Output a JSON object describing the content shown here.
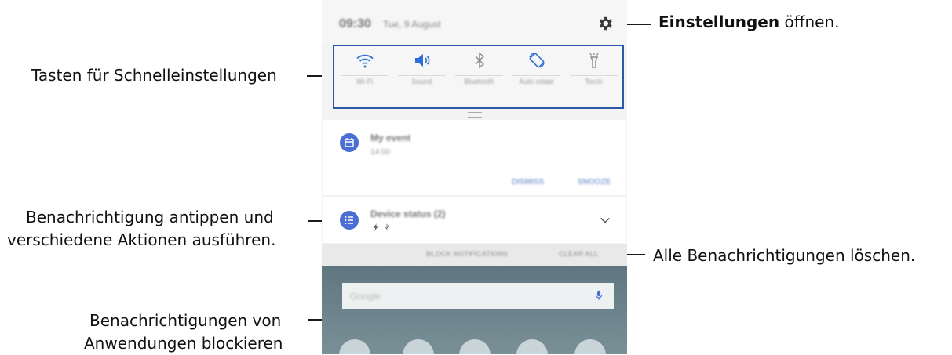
{
  "status_bar": {
    "time": "09:30",
    "date": "Tue, 9 August"
  },
  "quick_settings": [
    {
      "label": "Wi-Fi",
      "icon": "wifi-icon"
    },
    {
      "label": "Sound",
      "icon": "volume-icon"
    },
    {
      "label": "Bluetooth",
      "icon": "bluetooth-icon"
    },
    {
      "label": "Auto rotate",
      "icon": "rotate-icon"
    },
    {
      "label": "Torch",
      "icon": "flashlight-icon"
    }
  ],
  "notifications": [
    {
      "title": "My event",
      "subtitle": "14:00",
      "actions": [
        "DISMISS",
        "SNOOZE"
      ],
      "icon": "calendar-icon"
    },
    {
      "title": "Device status (2)",
      "icon": "list-icon"
    }
  ],
  "footer": {
    "block": "BLOCK NOTIFICATIONS",
    "clear": "CLEAR ALL"
  },
  "home": {
    "search_placeholder": "Google"
  },
  "callouts": {
    "settings_bold": "Einstellungen",
    "settings_rest": " öffnen.",
    "quick_settings": "Tasten für Schnelleinstellungen",
    "tap_line1": "Benachrichtigung antippen und",
    "tap_line2": "verschiedene Aktionen ausführen.",
    "clear_all": "Alle Benachrichtigungen löschen.",
    "block_line1": "Benachrichtigungen von",
    "block_line2": "Anwendungen blockieren"
  },
  "colors": {
    "highlight_border": "#2d57a8",
    "notification_icon": "#4a6ed1"
  }
}
